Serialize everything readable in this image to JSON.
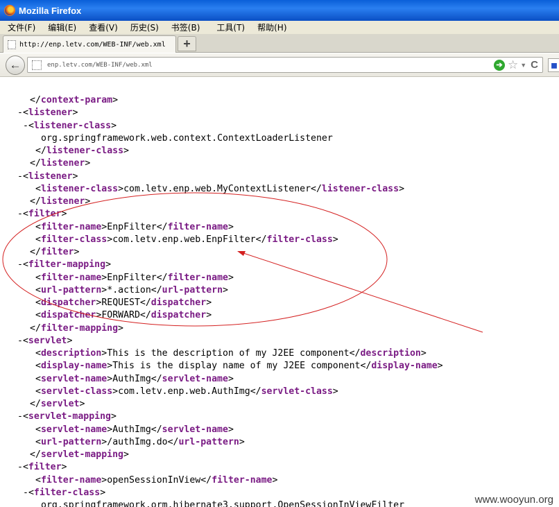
{
  "window": {
    "title": "Mozilla Firefox"
  },
  "menu": [
    "文件(F)",
    "编辑(E)",
    "查看(V)",
    "历史(S)",
    "书签(B)",
    "工具(T)",
    "帮助(H)"
  ],
  "tab": {
    "label": "http://enp.letv.com/WEB-INF/web.xml",
    "new_tab": "+"
  },
  "navbar": {
    "back": "←",
    "url": "enp.letv.com/WEB-INF/web.xml",
    "go": "➔",
    "bookmark_star": "☆",
    "dropdown": "▼",
    "reload": "C"
  },
  "xml_lines": [
    {
      "indent": 1,
      "toggle": "",
      "parts": [
        [
          "b",
          "</"
        ],
        [
          "t",
          "context-param"
        ],
        [
          "b",
          ">"
        ]
      ]
    },
    {
      "indent": 0,
      "toggle": "-",
      "parts": [
        [
          "b",
          "<"
        ],
        [
          "t",
          "listener"
        ],
        [
          "b",
          ">"
        ]
      ]
    },
    {
      "indent": 1,
      "toggle": "-",
      "parts": [
        [
          "b",
          "<"
        ],
        [
          "t",
          "listener-class"
        ],
        [
          "b",
          ">"
        ]
      ]
    },
    {
      "indent": 3,
      "toggle": "",
      "parts": [
        [
          "x",
          "org.springframework.web.context.ContextLoaderListener"
        ]
      ]
    },
    {
      "indent": 2,
      "toggle": "",
      "parts": [
        [
          "b",
          "</"
        ],
        [
          "t",
          "listener-class"
        ],
        [
          "b",
          ">"
        ]
      ]
    },
    {
      "indent": 1,
      "toggle": "",
      "parts": [
        [
          "b",
          "</"
        ],
        [
          "t",
          "listener"
        ],
        [
          "b",
          ">"
        ]
      ]
    },
    {
      "indent": 0,
      "toggle": "-",
      "parts": [
        [
          "b",
          "<"
        ],
        [
          "t",
          "listener"
        ],
        [
          "b",
          ">"
        ]
      ]
    },
    {
      "indent": 2,
      "toggle": "",
      "parts": [
        [
          "b",
          "<"
        ],
        [
          "t",
          "listener-class"
        ],
        [
          "b",
          ">"
        ],
        [
          "x",
          "com.letv.enp.web.MyContextListener"
        ],
        [
          "b",
          "</"
        ],
        [
          "t",
          "listener-class"
        ],
        [
          "b",
          ">"
        ]
      ]
    },
    {
      "indent": 1,
      "toggle": "",
      "parts": [
        [
          "b",
          "</"
        ],
        [
          "t",
          "listener"
        ],
        [
          "b",
          ">"
        ]
      ]
    },
    {
      "indent": 0,
      "toggle": "-",
      "parts": [
        [
          "b",
          "<"
        ],
        [
          "t",
          "filter"
        ],
        [
          "b",
          ">"
        ]
      ]
    },
    {
      "indent": 2,
      "toggle": "",
      "parts": [
        [
          "b",
          "<"
        ],
        [
          "t",
          "filter-name"
        ],
        [
          "b",
          ">"
        ],
        [
          "x",
          "EnpFilter"
        ],
        [
          "b",
          "</"
        ],
        [
          "t",
          "filter-name"
        ],
        [
          "b",
          ">"
        ]
      ]
    },
    {
      "indent": 2,
      "toggle": "",
      "parts": [
        [
          "b",
          "<"
        ],
        [
          "t",
          "filter-class"
        ],
        [
          "b",
          ">"
        ],
        [
          "x",
          "com.letv.enp.web.EnpFilter"
        ],
        [
          "b",
          "</"
        ],
        [
          "t",
          "filter-class"
        ],
        [
          "b",
          ">"
        ]
      ]
    },
    {
      "indent": 1,
      "toggle": "",
      "parts": [
        [
          "b",
          "</"
        ],
        [
          "t",
          "filter"
        ],
        [
          "b",
          ">"
        ]
      ]
    },
    {
      "indent": 0,
      "toggle": "-",
      "parts": [
        [
          "b",
          "<"
        ],
        [
          "t",
          "filter-mapping"
        ],
        [
          "b",
          ">"
        ]
      ]
    },
    {
      "indent": 2,
      "toggle": "",
      "parts": [
        [
          "b",
          "<"
        ],
        [
          "t",
          "filter-name"
        ],
        [
          "b",
          ">"
        ],
        [
          "x",
          "EnpFilter"
        ],
        [
          "b",
          "</"
        ],
        [
          "t",
          "filter-name"
        ],
        [
          "b",
          ">"
        ]
      ]
    },
    {
      "indent": 2,
      "toggle": "",
      "parts": [
        [
          "b",
          "<"
        ],
        [
          "t",
          "url-pattern"
        ],
        [
          "b",
          ">"
        ],
        [
          "x",
          "*.action"
        ],
        [
          "b",
          "</"
        ],
        [
          "t",
          "url-pattern"
        ],
        [
          "b",
          ">"
        ]
      ]
    },
    {
      "indent": 2,
      "toggle": "",
      "parts": [
        [
          "b",
          "<"
        ],
        [
          "t",
          "dispatcher"
        ],
        [
          "b",
          ">"
        ],
        [
          "x",
          "REQUEST"
        ],
        [
          "b",
          "</"
        ],
        [
          "t",
          "dispatcher"
        ],
        [
          "b",
          ">"
        ]
      ]
    },
    {
      "indent": 2,
      "toggle": "",
      "parts": [
        [
          "b",
          "<"
        ],
        [
          "t",
          "dispatcher"
        ],
        [
          "b",
          ">"
        ],
        [
          "x",
          "FORWARD"
        ],
        [
          "b",
          "</"
        ],
        [
          "t",
          "dispatcher"
        ],
        [
          "b",
          ">"
        ]
      ]
    },
    {
      "indent": 1,
      "toggle": "",
      "parts": [
        [
          "b",
          "</"
        ],
        [
          "t",
          "filter-mapping"
        ],
        [
          "b",
          ">"
        ]
      ]
    },
    {
      "indent": 0,
      "toggle": "-",
      "parts": [
        [
          "b",
          "<"
        ],
        [
          "t",
          "servlet"
        ],
        [
          "b",
          ">"
        ]
      ]
    },
    {
      "indent": 2,
      "toggle": "",
      "parts": [
        [
          "b",
          "<"
        ],
        [
          "t",
          "description"
        ],
        [
          "b",
          ">"
        ],
        [
          "x",
          "This is the description of my J2EE component"
        ],
        [
          "b",
          "</"
        ],
        [
          "t",
          "description"
        ],
        [
          "b",
          ">"
        ]
      ]
    },
    {
      "indent": 2,
      "toggle": "",
      "parts": [
        [
          "b",
          "<"
        ],
        [
          "t",
          "display-name"
        ],
        [
          "b",
          ">"
        ],
        [
          "x",
          "This is the display name of my J2EE component"
        ],
        [
          "b",
          "</"
        ],
        [
          "t",
          "display-name"
        ],
        [
          "b",
          ">"
        ]
      ]
    },
    {
      "indent": 2,
      "toggle": "",
      "parts": [
        [
          "b",
          "<"
        ],
        [
          "t",
          "servlet-name"
        ],
        [
          "b",
          ">"
        ],
        [
          "x",
          "AuthImg"
        ],
        [
          "b",
          "</"
        ],
        [
          "t",
          "servlet-name"
        ],
        [
          "b",
          ">"
        ]
      ]
    },
    {
      "indent": 2,
      "toggle": "",
      "parts": [
        [
          "b",
          "<"
        ],
        [
          "t",
          "servlet-class"
        ],
        [
          "b",
          ">"
        ],
        [
          "x",
          "com.letv.enp.web.AuthImg"
        ],
        [
          "b",
          "</"
        ],
        [
          "t",
          "servlet-class"
        ],
        [
          "b",
          ">"
        ]
      ]
    },
    {
      "indent": 1,
      "toggle": "",
      "parts": [
        [
          "b",
          "</"
        ],
        [
          "t",
          "servlet"
        ],
        [
          "b",
          ">"
        ]
      ]
    },
    {
      "indent": 0,
      "toggle": "-",
      "parts": [
        [
          "b",
          "<"
        ],
        [
          "t",
          "servlet-mapping"
        ],
        [
          "b",
          ">"
        ]
      ]
    },
    {
      "indent": 2,
      "toggle": "",
      "parts": [
        [
          "b",
          "<"
        ],
        [
          "t",
          "servlet-name"
        ],
        [
          "b",
          ">"
        ],
        [
          "x",
          "AuthImg"
        ],
        [
          "b",
          "</"
        ],
        [
          "t",
          "servlet-name"
        ],
        [
          "b",
          ">"
        ]
      ]
    },
    {
      "indent": 2,
      "toggle": "",
      "parts": [
        [
          "b",
          "<"
        ],
        [
          "t",
          "url-pattern"
        ],
        [
          "b",
          ">"
        ],
        [
          "x",
          "/authImg.do"
        ],
        [
          "b",
          "</"
        ],
        [
          "t",
          "url-pattern"
        ],
        [
          "b",
          ">"
        ]
      ]
    },
    {
      "indent": 1,
      "toggle": "",
      "parts": [
        [
          "b",
          "</"
        ],
        [
          "t",
          "servlet-mapping"
        ],
        [
          "b",
          ">"
        ]
      ]
    },
    {
      "indent": 0,
      "toggle": "-",
      "parts": [
        [
          "b",
          "<"
        ],
        [
          "t",
          "filter"
        ],
        [
          "b",
          ">"
        ]
      ]
    },
    {
      "indent": 2,
      "toggle": "",
      "parts": [
        [
          "b",
          "<"
        ],
        [
          "t",
          "filter-name"
        ],
        [
          "b",
          ">"
        ],
        [
          "x",
          "openSessionInView"
        ],
        [
          "b",
          "</"
        ],
        [
          "t",
          "filter-name"
        ],
        [
          "b",
          ">"
        ]
      ]
    },
    {
      "indent": 1,
      "toggle": "-",
      "parts": [
        [
          "b",
          "<"
        ],
        [
          "t",
          "filter-class"
        ],
        [
          "b",
          ">"
        ]
      ]
    },
    {
      "indent": 3,
      "toggle": "",
      "parts": [
        [
          "x",
          "org.springframework.orm.hibernate3.support.OpenSessionInViewFilter"
        ]
      ]
    }
  ],
  "annotation": {
    "color": "#d42020"
  },
  "watermark": "www.wooyun.org"
}
